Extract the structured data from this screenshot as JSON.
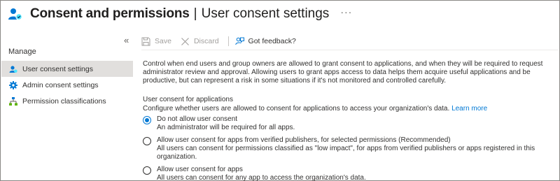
{
  "header": {
    "title": "Consent and permissions",
    "separator": "|",
    "subtitle": "User consent settings",
    "more": "···"
  },
  "sidebar": {
    "collapse": "«",
    "section_label": "Manage",
    "items": [
      {
        "label": "User consent settings",
        "icon": "user-icon",
        "active": true
      },
      {
        "label": "Admin consent settings",
        "icon": "gear-icon",
        "active": false
      },
      {
        "label": "Permission classifications",
        "icon": "hierarchy-icon",
        "active": false
      }
    ]
  },
  "toolbar": {
    "save_label": "Save",
    "discard_label": "Discard",
    "feedback_label": "Got feedback?"
  },
  "main": {
    "description": "Control when end users and group owners are allowed to grant consent to applications, and when they will be required to request administrator review and approval. Allowing users to grant apps access to data helps them acquire useful applications and be productive, but can represent a risk in some situations if it's not monitored and controlled carefully.",
    "section_title": "User consent for applications",
    "section_description": "Configure whether users are allowed to consent for applications to access your organization's data.",
    "learn_more": "Learn more",
    "options": [
      {
        "title": "Do not allow user consent",
        "description": "An administrator will be required for all apps.",
        "selected": true
      },
      {
        "title": "Allow user consent for apps from verified publishers, for selected permissions (Recommended)",
        "description": "All users can consent for permissions classified as \"low impact\", for apps from verified publishers or apps registered in this organization.",
        "selected": false
      },
      {
        "title": "Allow user consent for apps",
        "description": "All users can consent for any app to access the organization's data.",
        "selected": false
      }
    ]
  },
  "colors": {
    "accent": "#0078d4",
    "active_nav_bg": "#e1dfdd",
    "text": "#323130",
    "disabled": "#a19f9d"
  }
}
